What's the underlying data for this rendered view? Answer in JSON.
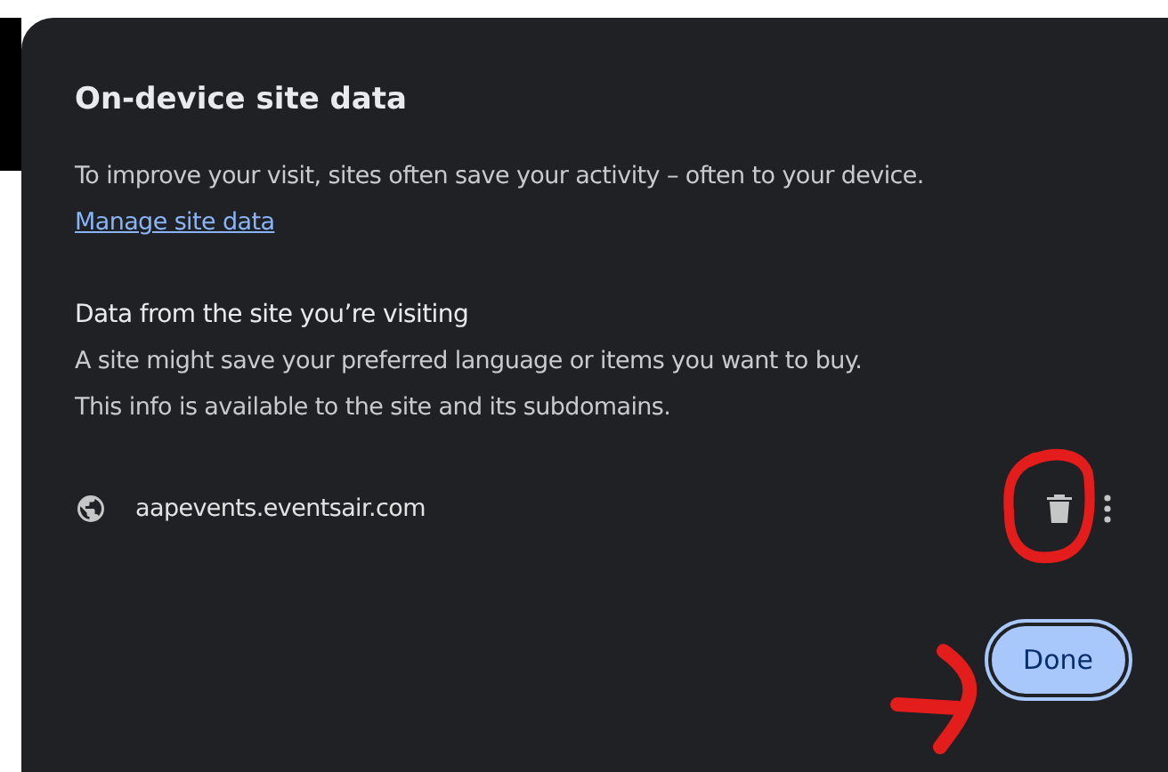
{
  "dialog": {
    "title": "On-device site data",
    "intro": "To improve your visit, sites often save your activity – often to your device.",
    "manage_link": "Manage site data",
    "section_heading": "Data from the site you’re visiting",
    "section_lines": [
      "A site might save your preferred language or items you want to buy.",
      "This info is available to the site and its subdomains."
    ],
    "sites": [
      {
        "domain": "aapevents.eventsair.com"
      }
    ],
    "done_button": "Done"
  }
}
